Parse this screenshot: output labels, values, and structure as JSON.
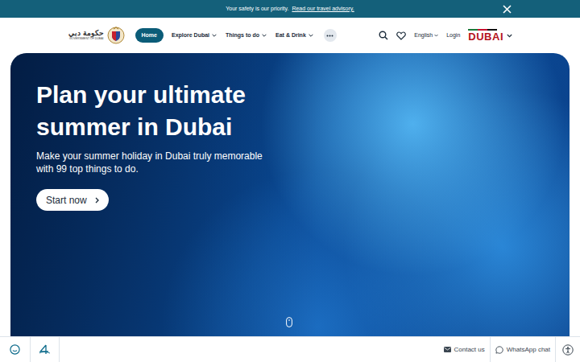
{
  "banner": {
    "message": "Your safety is our priority.",
    "link": "Read our travel advisory."
  },
  "logo": {
    "arabic": "حكومة دبي",
    "english": "GOVERNMENT OF DUBAI"
  },
  "nav": {
    "items": [
      {
        "label": "Home",
        "selected": true,
        "has_menu": false
      },
      {
        "label": "Explore Dubai",
        "selected": false,
        "has_menu": true
      },
      {
        "label": "Things to do",
        "selected": false,
        "has_menu": true
      },
      {
        "label": "Eat & Drink",
        "selected": false,
        "has_menu": true
      }
    ],
    "language": "English",
    "login": "Login",
    "brand": "DUBAI"
  },
  "hero": {
    "title": "Plan your ultimate summer in Dubai",
    "subtitle": "Make your summer holiday in Dubai truly memorable with 99 top things to do.",
    "cta": "Start now"
  },
  "footer": {
    "contact": "Contact us",
    "whatsapp": "WhatsApp chat"
  }
}
